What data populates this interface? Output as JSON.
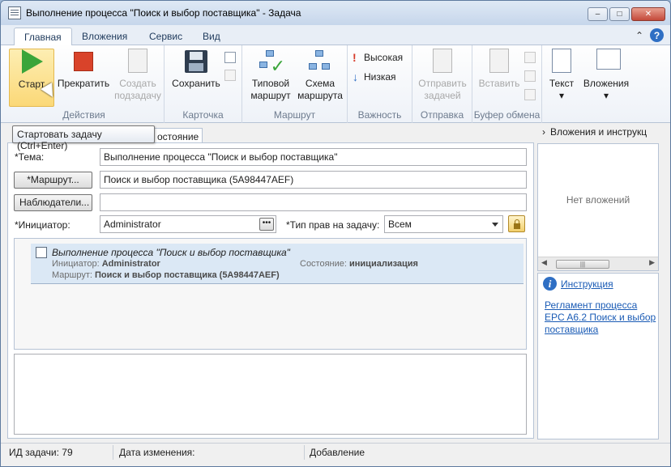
{
  "window": {
    "title": "Выполнение процесса \"Поиск и выбор поставщика\" - Задача"
  },
  "tabs": [
    {
      "label": "Главная"
    },
    {
      "label": "Вложения"
    },
    {
      "label": "Сервис"
    },
    {
      "label": "Вид"
    }
  ],
  "ribbon": {
    "actions": {
      "label": "Действия",
      "start": "Старт",
      "stop": "Прекратить",
      "create_sub1": "Создать",
      "create_sub2": "подзадачу"
    },
    "card": {
      "label": "Карточка",
      "save": "Сохранить"
    },
    "route": {
      "label": "Маршрут",
      "typical1": "Типовой",
      "typical2": "маршрут",
      "scheme1": "Схема",
      "scheme2": "маршрута"
    },
    "importance": {
      "label": "Важность",
      "high": "Высокая",
      "low": "Низкая"
    },
    "send": {
      "label": "Отправка",
      "send1": "Отправить",
      "send2": "задачей"
    },
    "clipboard": {
      "label": "Буфер обмена",
      "paste": "Вставить"
    },
    "text": {
      "label": "Текст"
    },
    "attachments": {
      "label": "Вложения"
    }
  },
  "tooltip": "Стартовать задачу (Ctrl+Enter)",
  "subtab_label": "остояние",
  "form": {
    "subject_label": "*Тема:",
    "subject_value": "Выполнение процесса \"Поиск и выбор поставщика\"",
    "route_button": "*Маршрут...",
    "route_value": "Поиск и выбор поставщика (5A98447AEF)",
    "observers_button": "Наблюдатели...",
    "observers_value": "",
    "initiator_label": "*Инициатор:",
    "initiator_value": "Administrator",
    "rights_label": "*Тип прав на задачу:",
    "rights_value": "Всем"
  },
  "process": {
    "title": "Выполнение процесса \"Поиск и выбор поставщика\"",
    "initiator_label": "Инициатор:",
    "initiator_value": "Administrator",
    "state_label": "Состояние:",
    "state_value": "инициализация",
    "route_label": "Маршрут:",
    "route_value": "Поиск и выбор поставщика (5A98447AEF)"
  },
  "side": {
    "header": "Вложения и инструкц",
    "no_attachments": "Нет вложений",
    "instruction": "Инструкция",
    "reglament": "Регламент процесса EPC A6.2 Поиск и выбор поставщика"
  },
  "status": {
    "task_id": "ИД задачи: 79",
    "modified": "Дата изменения:",
    "added": "Добавление"
  }
}
